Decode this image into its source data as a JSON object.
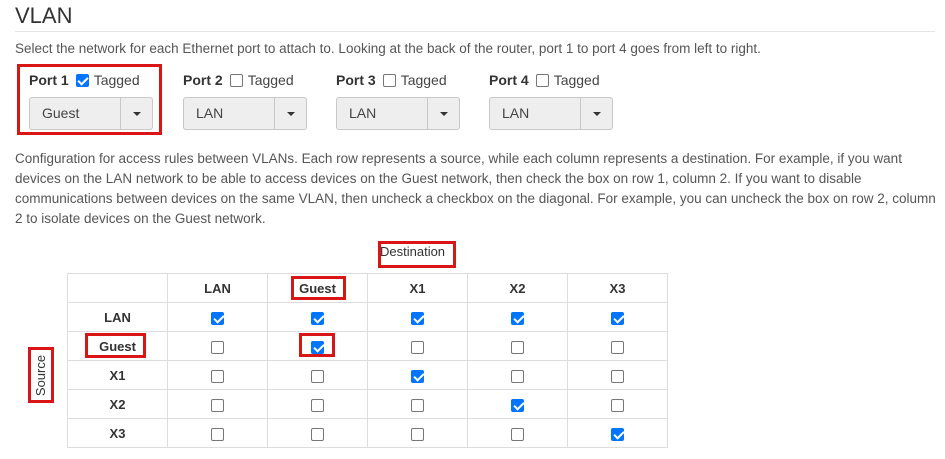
{
  "page": {
    "title": "VLAN",
    "port_instructions": "Select the network for each Ethernet port to attach to. Looking at the back of the router, port 1 to port 4 goes from left to right.",
    "access_instructions": "Configuration for access rules between VLANs. Each row represents a source, while each column represents a destination. For example, if you want devices on the LAN network to be able to access devices on the Guest network, then check the box on row 1, column 2. If you want to disable communications between devices on the same VLAN, then uncheck a checkbox on the diagonal. For example, you can uncheck the box on row 2, column 2 to isolate devices on the Guest network."
  },
  "ports": [
    {
      "label": "Port 1",
      "tagged_label": "Tagged",
      "tagged": true,
      "network": "Guest"
    },
    {
      "label": "Port 2",
      "tagged_label": "Tagged",
      "tagged": false,
      "network": "LAN"
    },
    {
      "label": "Port 3",
      "tagged_label": "Tagged",
      "tagged": false,
      "network": "LAN"
    },
    {
      "label": "Port 4",
      "tagged_label": "Tagged",
      "tagged": false,
      "network": "LAN"
    }
  ],
  "matrix": {
    "destination_label": "Destination",
    "source_label": "Source",
    "columns": [
      "LAN",
      "Guest",
      "X1",
      "X2",
      "X3"
    ],
    "rows": [
      {
        "label": "LAN",
        "checked": [
          true,
          true,
          true,
          true,
          true
        ]
      },
      {
        "label": "Guest",
        "checked": [
          false,
          true,
          false,
          false,
          false
        ]
      },
      {
        "label": "X1",
        "checked": [
          false,
          false,
          true,
          false,
          false
        ]
      },
      {
        "label": "X2",
        "checked": [
          false,
          false,
          false,
          true,
          false
        ]
      },
      {
        "label": "X3",
        "checked": [
          false,
          false,
          false,
          false,
          true
        ]
      }
    ]
  },
  "colors": {
    "highlight": "#d91515",
    "checkbox_checked": "#0075ff"
  }
}
